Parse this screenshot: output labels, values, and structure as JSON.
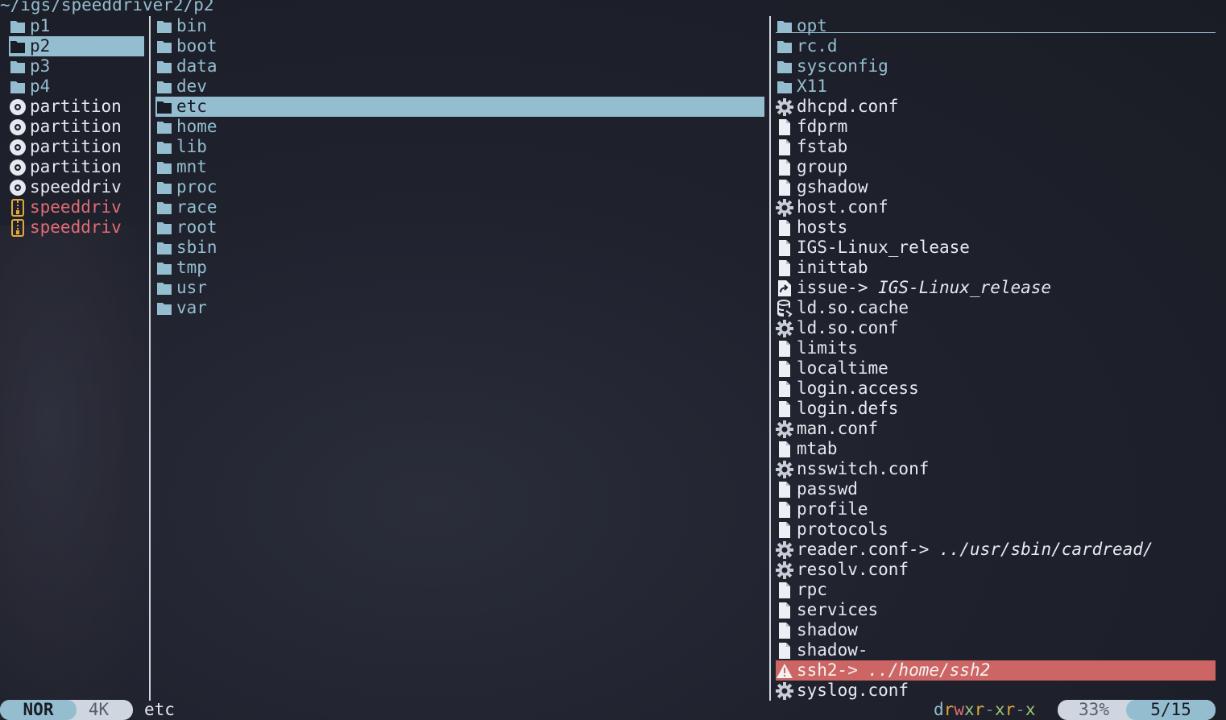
{
  "header": {
    "path": "~/igs/speeddriver2/p2"
  },
  "parent_pane": {
    "items": [
      {
        "name": "p1",
        "icon": "folder-icon",
        "kind": "dir"
      },
      {
        "name": "p2",
        "icon": "folder-icon",
        "kind": "dir",
        "selected": true
      },
      {
        "name": "p3",
        "icon": "folder-icon",
        "kind": "dir"
      },
      {
        "name": "p4",
        "icon": "folder-icon",
        "kind": "dir"
      },
      {
        "name": "partition",
        "icon": "disc-icon",
        "kind": "file"
      },
      {
        "name": "partition",
        "icon": "disc-icon",
        "kind": "file"
      },
      {
        "name": "partition",
        "icon": "disc-icon",
        "kind": "file"
      },
      {
        "name": "partition",
        "icon": "disc-icon",
        "kind": "file"
      },
      {
        "name": "speeddriv",
        "icon": "disc-icon",
        "kind": "file"
      },
      {
        "name": "speeddriv",
        "icon": "archive-icon",
        "kind": "archive"
      },
      {
        "name": "speeddriv",
        "icon": "archive-icon",
        "kind": "archive"
      }
    ]
  },
  "current_pane": {
    "items": [
      {
        "name": "bin",
        "icon": "folder-icon"
      },
      {
        "name": "boot",
        "icon": "folder-icon"
      },
      {
        "name": "data",
        "icon": "folder-icon"
      },
      {
        "name": "dev",
        "icon": "folder-icon"
      },
      {
        "name": "etc",
        "icon": "folder-icon",
        "selected": true
      },
      {
        "name": "home",
        "icon": "folder-icon"
      },
      {
        "name": "lib",
        "icon": "folder-icon"
      },
      {
        "name": "mnt",
        "icon": "folder-icon"
      },
      {
        "name": "proc",
        "icon": "folder-icon"
      },
      {
        "name": "race",
        "icon": "folder-icon"
      },
      {
        "name": "root",
        "icon": "folder-icon"
      },
      {
        "name": "sbin",
        "icon": "folder-icon"
      },
      {
        "name": "tmp",
        "icon": "folder-icon"
      },
      {
        "name": "usr",
        "icon": "folder-icon"
      },
      {
        "name": "var",
        "icon": "folder-icon"
      }
    ]
  },
  "preview_pane": {
    "items": [
      {
        "name": "opt",
        "icon": "folder-icon",
        "kind": "dir"
      },
      {
        "name": "rc.d",
        "icon": "folder-icon",
        "kind": "dir"
      },
      {
        "name": "sysconfig",
        "icon": "folder-icon",
        "kind": "dir"
      },
      {
        "name": "X11",
        "icon": "folder-icon",
        "kind": "dir"
      },
      {
        "name": "dhcpd.conf",
        "icon": "gear-icon"
      },
      {
        "name": "fdprm",
        "icon": "file-icon"
      },
      {
        "name": "fstab",
        "icon": "file-icon"
      },
      {
        "name": "group",
        "icon": "file-icon"
      },
      {
        "name": "gshadow",
        "icon": "file-icon"
      },
      {
        "name": "host.conf",
        "icon": "gear-icon"
      },
      {
        "name": "hosts",
        "icon": "file-icon"
      },
      {
        "name": "IGS-Linux_release",
        "icon": "file-icon"
      },
      {
        "name": "inittab",
        "icon": "file-icon"
      },
      {
        "name": "issue",
        "icon": "symlink-icon",
        "target": "IGS-Linux_release"
      },
      {
        "name": "ld.so.cache",
        "icon": "database-icon"
      },
      {
        "name": "ld.so.conf",
        "icon": "gear-icon"
      },
      {
        "name": "limits",
        "icon": "file-icon"
      },
      {
        "name": "localtime",
        "icon": "file-icon"
      },
      {
        "name": "login.access",
        "icon": "file-icon"
      },
      {
        "name": "login.defs",
        "icon": "file-icon"
      },
      {
        "name": "man.conf",
        "icon": "gear-icon"
      },
      {
        "name": "mtab",
        "icon": "file-icon"
      },
      {
        "name": "nsswitch.conf",
        "icon": "gear-icon"
      },
      {
        "name": "passwd",
        "icon": "file-icon"
      },
      {
        "name": "profile",
        "icon": "file-icon"
      },
      {
        "name": "protocols",
        "icon": "file-icon"
      },
      {
        "name": "reader.conf",
        "icon": "gear-icon",
        "target": "../usr/sbin/cardread/"
      },
      {
        "name": "resolv.conf",
        "icon": "gear-icon"
      },
      {
        "name": "rpc",
        "icon": "file-icon"
      },
      {
        "name": "services",
        "icon": "file-icon"
      },
      {
        "name": "shadow",
        "icon": "file-icon"
      },
      {
        "name": "shadow-",
        "icon": "file-icon"
      },
      {
        "name": "ssh2",
        "icon": "warning-icon",
        "target": "../home/ssh2",
        "broken": true
      },
      {
        "name": "syslog.conf",
        "icon": "gear-icon"
      }
    ]
  },
  "statusbar": {
    "mode": "NOR",
    "size": "4K",
    "filename": "etc",
    "permissions": "drwxr-xr-x",
    "percent": "33%",
    "position": "5/15"
  },
  "colors": {
    "accent": "#94bed0",
    "warn": "#cd6564",
    "archive": "#e0a83a",
    "red": "#e06c75"
  }
}
